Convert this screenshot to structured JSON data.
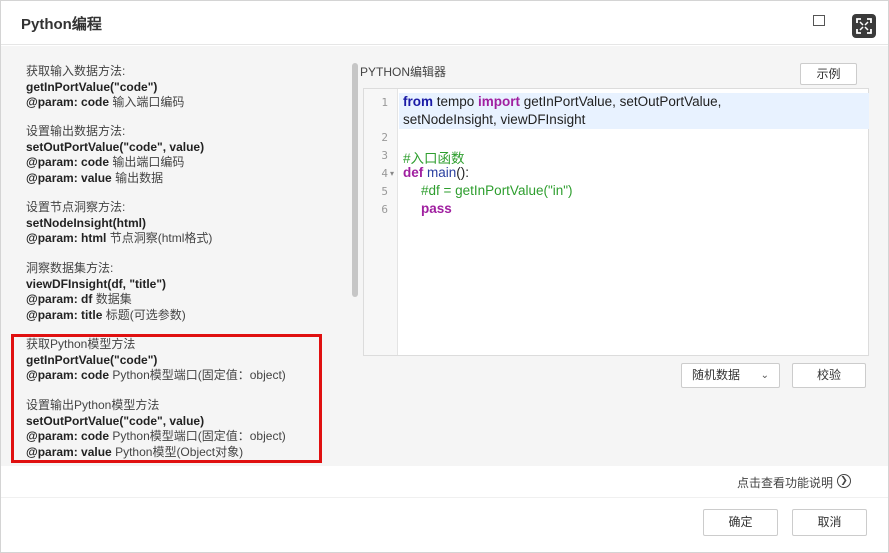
{
  "dialog": {
    "title": "Python编程"
  },
  "docs": [
    {
      "heading": "获取输入数据方法:",
      "signature": "getInPortValue(\"code\")",
      "params": [
        {
          "label": "@param: code",
          "desc": "输入端口编码"
        }
      ]
    },
    {
      "heading": "设置输出数据方法:",
      "signature": "setOutPortValue(\"code\", value)",
      "params": [
        {
          "label": "@param: code",
          "desc": "输出端口编码"
        },
        {
          "label": "@param: value",
          "desc": "输出数据"
        }
      ]
    },
    {
      "heading": "设置节点洞察方法:",
      "signature": "setNodeInsight(html)",
      "params": [
        {
          "label": "@param: html",
          "desc": "节点洞察(html格式)"
        }
      ]
    },
    {
      "heading": "洞察数据集方法:",
      "signature": "viewDFInsight(df, \"title\")",
      "params": [
        {
          "label": "@param: df",
          "desc": "数据集"
        },
        {
          "label": "@param: title",
          "desc": "标题(可选参数)"
        }
      ]
    },
    {
      "heading": "获取Python模型方法",
      "signature": "getInPortValue(\"code\")",
      "params": [
        {
          "label": "@param: code",
          "desc": "Python模型端口(固定值：object)"
        }
      ]
    },
    {
      "heading": "设置输出Python模型方法",
      "signature": "setOutPortValue(\"code\", value)",
      "params": [
        {
          "label": "@param: code",
          "desc": "Python模型端口(固定值：object)"
        },
        {
          "label": "@param: value",
          "desc": "Python模型(Object对象)"
        }
      ]
    }
  ],
  "editor": {
    "label": "PYTHON编辑器",
    "example_button": "示例",
    "line_numbers": [
      "1",
      "2",
      "3",
      "4",
      "5",
      "6"
    ],
    "code": {
      "l1_from": "from",
      "l1_mod": " tempo ",
      "l1_import": "import",
      "l1_rest": " getInPortValue, setOutPortValue,",
      "l1_cont": "setNodeInsight, viewDFInsight",
      "l3_comment": "#入口函数",
      "l4_def": "def",
      "l4_name": " main",
      "l4_rest": "():",
      "l5_comment": "#df = getInPortValue(\"in\")",
      "l6_pass": "pass"
    }
  },
  "controls": {
    "random_select_value": "随机数据",
    "validate_button": "校验"
  },
  "footer": {
    "help_link": "点击查看功能说明",
    "confirm_button": "确定",
    "cancel_button": "取消"
  },
  "colors": {
    "highlight_box": "#e01010",
    "keyword": "#a020a0",
    "comment": "#2e9e2e"
  }
}
